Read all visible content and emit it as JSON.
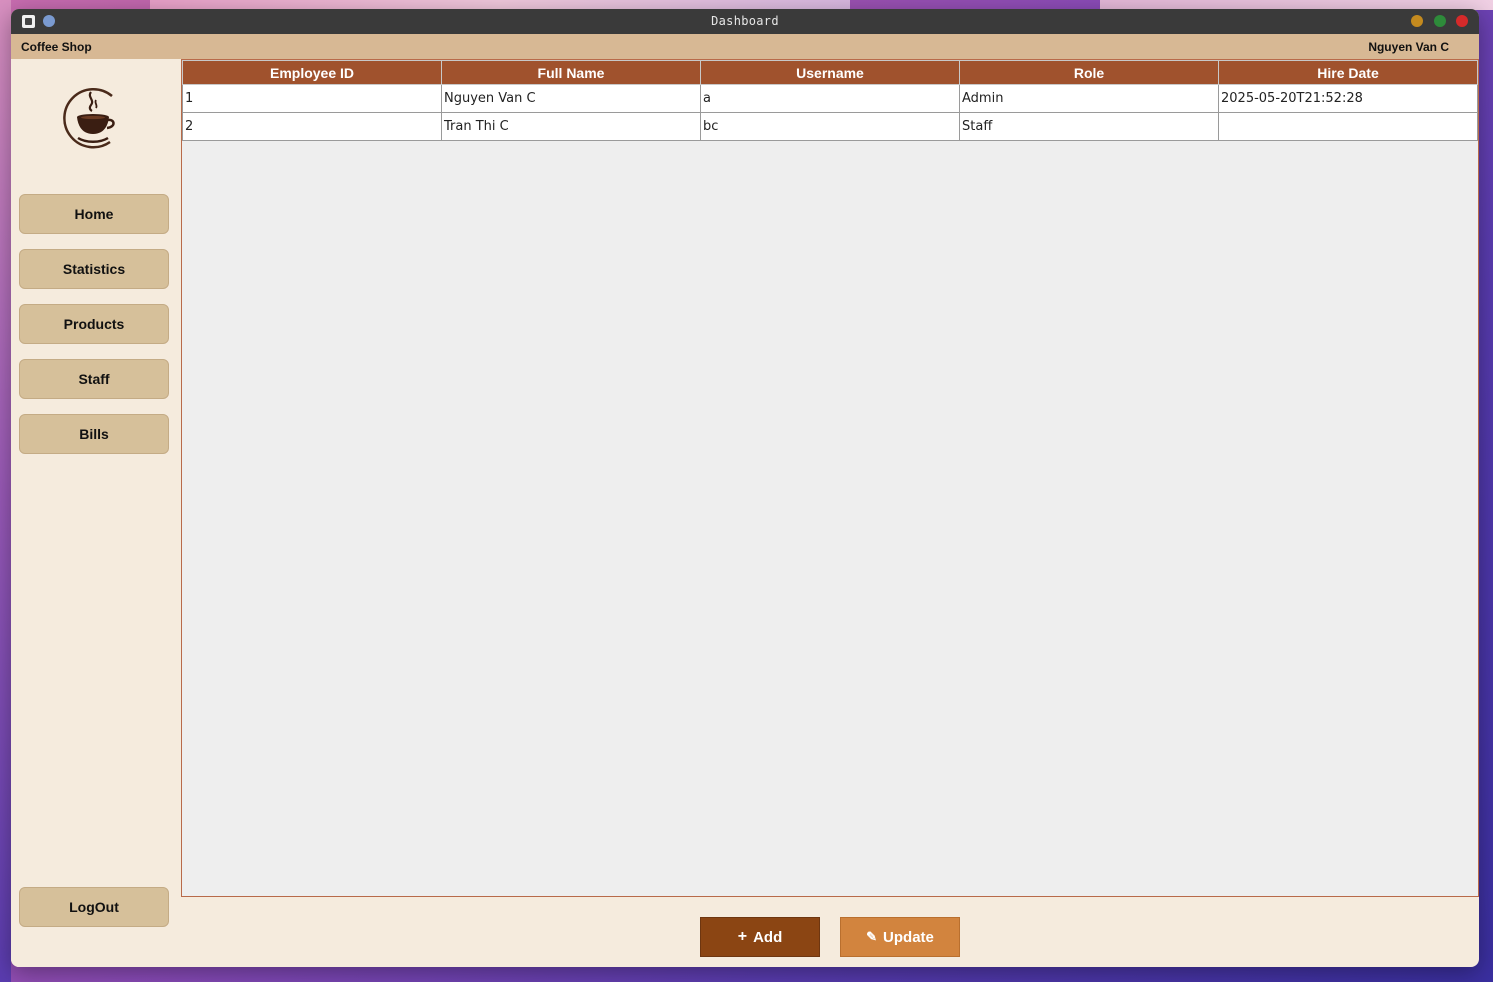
{
  "window": {
    "title": "Dashboard"
  },
  "menubar": {
    "brand": "Coffee Shop",
    "user": "Nguyen Van C"
  },
  "sidebar": {
    "items": [
      {
        "label": "Home"
      },
      {
        "label": "Statistics"
      },
      {
        "label": "Products"
      },
      {
        "label": "Staff"
      },
      {
        "label": "Bills"
      }
    ],
    "logout_label": "LogOut"
  },
  "table": {
    "columns": [
      "Employee ID",
      "Full Name",
      "Username",
      "Role",
      "Hire Date"
    ],
    "rows": [
      [
        "1",
        "Nguyen Van C",
        "a",
        "Admin",
        "2025-05-20T21:52:28"
      ],
      [
        "2",
        "Tran Thi C",
        "bc",
        "Staff",
        ""
      ]
    ]
  },
  "actions": {
    "add_label": "Add",
    "add_icon": "plus-icon",
    "update_label": "Update",
    "update_icon": "pencil-icon"
  },
  "colors": {
    "header_bg": "#a0522d",
    "menubar_bg": "#d7b894",
    "sidebar_button_bg": "#d6c09a",
    "add_button_bg": "#8b4513",
    "update_button_bg": "#d2843e",
    "content_bg": "#f5ebdd"
  }
}
